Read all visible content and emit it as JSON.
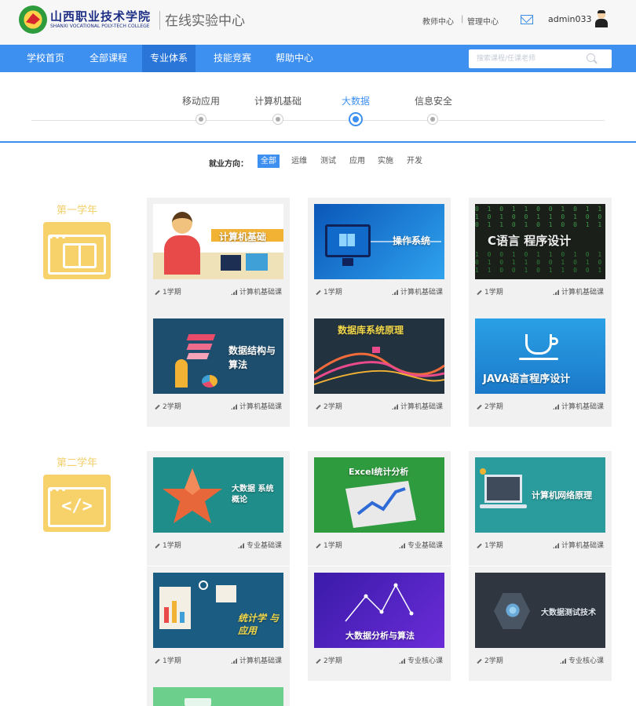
{
  "header": {
    "school_name": "山西职业技术学院",
    "school_en": "SHANXI VOCATIONAL POLY-TECH COLLEGE",
    "site_name": "在线实验中心",
    "teacher_link": "教师中心",
    "link_sep": "|",
    "admin_link": "管理中心",
    "username": "admin033"
  },
  "nav": {
    "items": [
      "学校首页",
      "全部课程",
      "专业体系",
      "技能竞赛",
      "帮助中心"
    ],
    "active_index": 2,
    "search_placeholder": "搜索课程/任课老师"
  },
  "categories": {
    "items": [
      "移动应用",
      "计算机基础",
      "大数据",
      "信息安全"
    ],
    "active_index": 2
  },
  "filter": {
    "label": "就业方向：",
    "options": [
      "全部",
      "运维",
      "测试",
      "应用",
      "实施",
      "开发"
    ],
    "active_index": 0
  },
  "years": [
    {
      "title": "第一学年",
      "icon": "book-icon"
    },
    {
      "title": "第二学年",
      "icon": "code-icon"
    }
  ],
  "courses": [
    {
      "thumb_text": "计算机基础",
      "term": "1学期",
      "type": "计算机基础课"
    },
    {
      "thumb_text": "操作系统",
      "term": "1学期",
      "type": "计算机基础课"
    },
    {
      "thumb_text": "C语言 程序设计",
      "term": "1学期",
      "type": "计算机基础课"
    },
    {
      "thumb_text": "数据结构与算法",
      "term": "2学期",
      "type": "计算机基础课"
    },
    {
      "thumb_text": "数据库系统原理",
      "term": "2学期",
      "type": "计算机基础课"
    },
    {
      "thumb_text": "JAVA语言程序设计",
      "term": "2学期",
      "type": "计算机基础课"
    },
    {
      "thumb_text": "大数据 系统概论",
      "term": "1学期",
      "type": "专业基础课"
    },
    {
      "thumb_text": "Excel统计分析",
      "term": "1学期",
      "type": "专业基础课"
    },
    {
      "thumb_text": "计算机网络原理",
      "term": "1学期",
      "type": "计算机基础课"
    },
    {
      "thumb_text": "统计学 与应用",
      "term": "1学期",
      "type": "计算机基础课"
    },
    {
      "thumb_text": "大数据分析与算法",
      "term": "2学期",
      "type": "专业核心课"
    },
    {
      "thumb_text": "大数据测试技术",
      "term": "2学期",
      "type": "专业核心课"
    }
  ],
  "colors": {
    "primary": "#3d8ff0",
    "year_accent": "#f7d26a"
  }
}
